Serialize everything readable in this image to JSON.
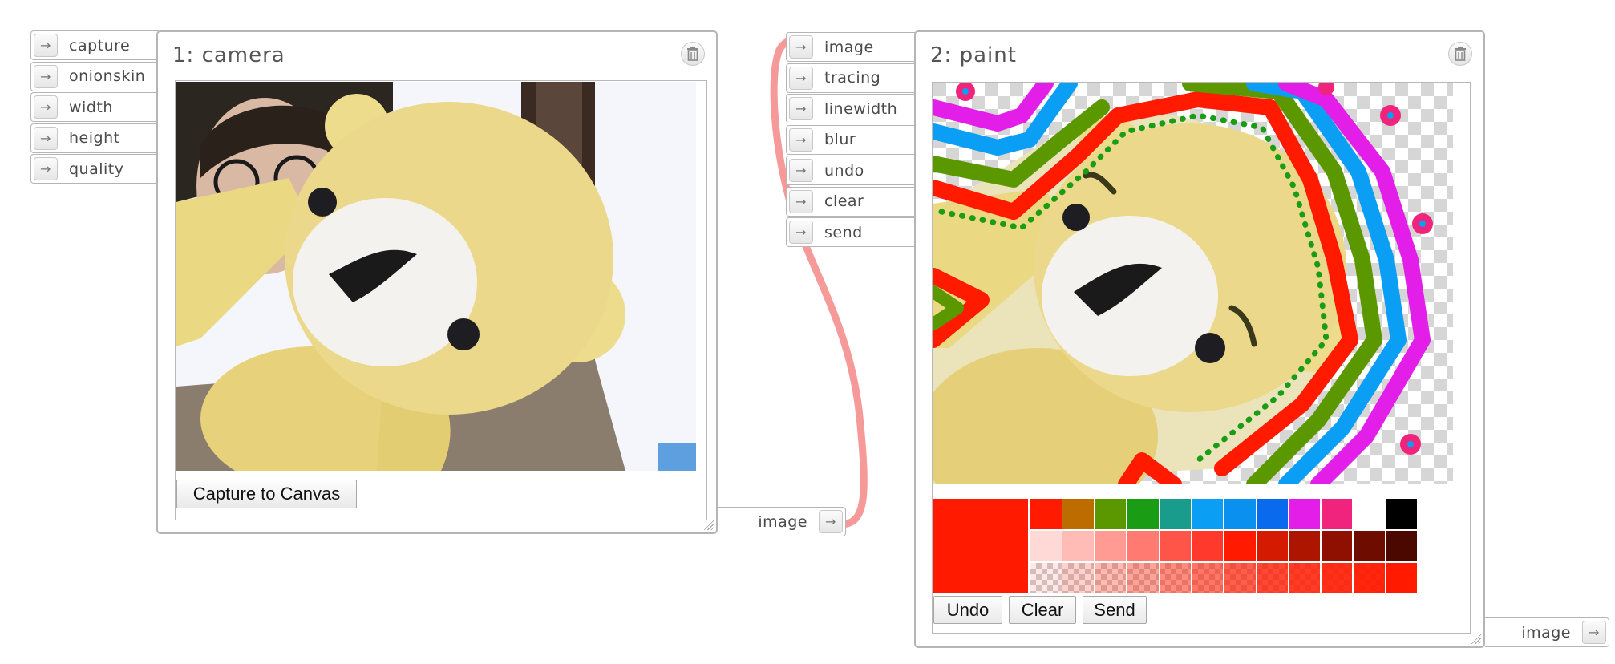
{
  "wire": {
    "color": "#f59a98"
  },
  "camera": {
    "title": "1: camera",
    "inputs": [
      "capture",
      "onionskin",
      "width",
      "height",
      "quality"
    ],
    "output": "image",
    "capture_button": "Capture to Canvas"
  },
  "paint": {
    "title": "2: paint",
    "inputs": [
      "image",
      "tracing",
      "linewidth",
      "blur",
      "undo",
      "clear",
      "send"
    ],
    "output": "image",
    "buttons": {
      "undo": "Undo",
      "clear": "Clear",
      "send": "Send"
    },
    "current_color": "#ff1a00",
    "palette_row1": [
      "#ff1a00",
      "#bd6d00",
      "#5b9800",
      "#1a9c14",
      "#1a9c8c",
      "#0a9ef5",
      "#0a90ee",
      "#0a6aee",
      "#e21ee8",
      "#f0247c",
      "#ffffff",
      "#000000"
    ],
    "palette_row2": [
      "#ffd9d6",
      "#ffbcb6",
      "#ff9b93",
      "#ff7a70",
      "#ff5548",
      "#ff3a2c",
      "#ff1a00",
      "#d41a00",
      "#ad1500",
      "#8f1000",
      "#6e0c00",
      "#4a0800"
    ],
    "palette_row3_alpha": [
      0.1,
      0.2,
      0.3,
      0.4,
      0.5,
      0.6,
      0.7,
      0.8,
      0.85,
      0.9,
      0.95,
      1.0
    ]
  },
  "icons": {
    "arrow": "arrow-right-icon",
    "trash": "trash-icon"
  }
}
